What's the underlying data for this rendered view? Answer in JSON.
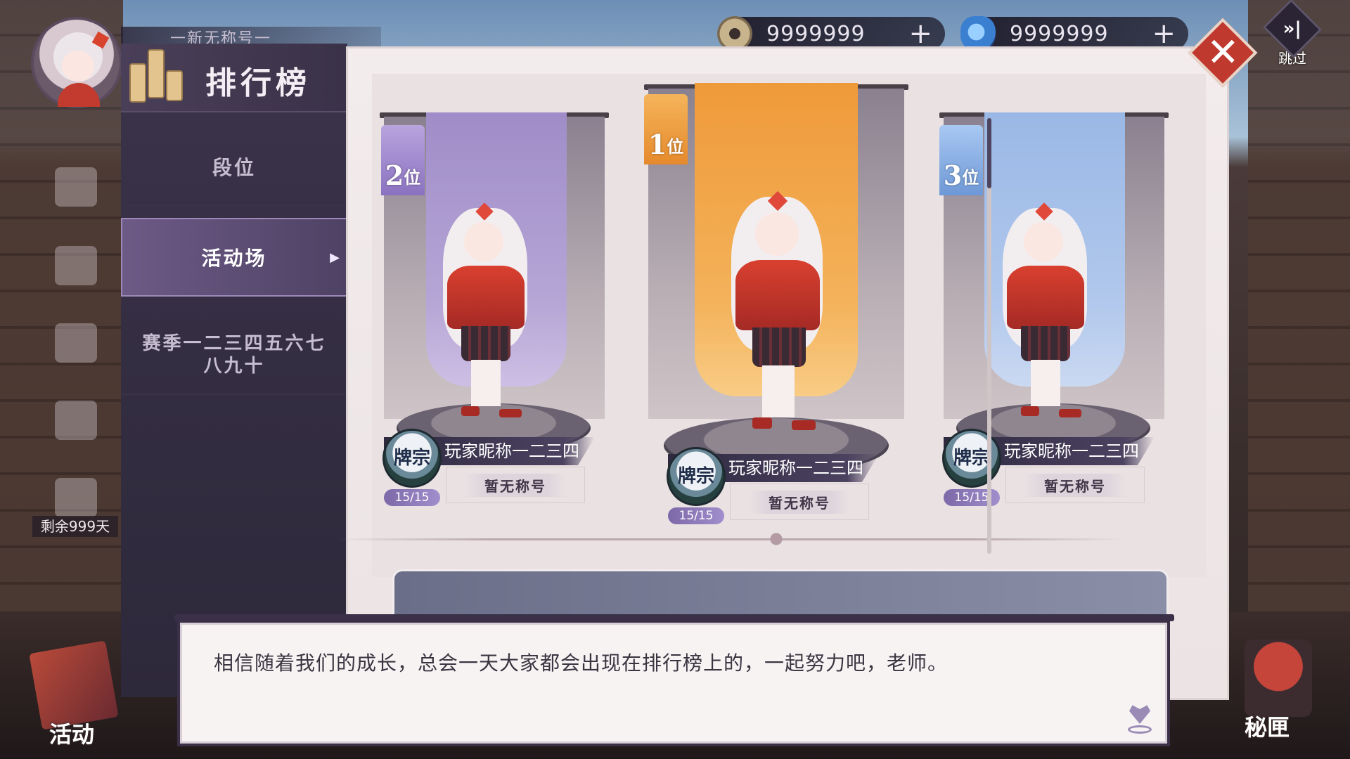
{
  "topbar": {
    "player_title": "一新无称号一",
    "currency_coin": {
      "value": "9999999",
      "plus": "+",
      "icon": "coin-icon"
    },
    "currency_gem": {
      "value": "9999999",
      "plus": "+",
      "icon": "cat-gem-icon"
    },
    "skip": {
      "icon": "skip-forward-icon",
      "label": "跳过"
    }
  },
  "sidebar": {
    "remaining": "剩余999天",
    "activity_label": "活动",
    "treasure_label": "秘匣"
  },
  "panel": {
    "title": "排行榜",
    "close_icon": "close-x-icon",
    "tabs": [
      {
        "label": "段位",
        "active": false
      },
      {
        "label": "活动场",
        "active": true
      },
      {
        "label": "赛季一二三四五六七八九十",
        "active": false
      }
    ]
  },
  "ranking": {
    "entries": [
      {
        "rank_num": "2",
        "rank_suffix": "位",
        "player_name": "玩家昵称一二三四",
        "title": "暂无称号",
        "tier_label": "牌宗",
        "tier_progress": "15/15",
        "color": "#9f87c6"
      },
      {
        "rank_num": "1",
        "rank_suffix": "位",
        "player_name": "玩家昵称一二三四",
        "title": "暂无称号",
        "tier_label": "牌宗",
        "tier_progress": "15/15",
        "color": "#f0a23c"
      },
      {
        "rank_num": "3",
        "rank_suffix": "位",
        "player_name": "玩家昵称一二三四",
        "title": "暂无称号",
        "tier_label": "牌宗",
        "tier_progress": "15/15",
        "color": "#8fb3e6"
      }
    ]
  },
  "dialog": {
    "text": "相信随着我们的成长，总会一天大家都会出现在排行榜上的，一起努力吧，老师。",
    "next_icon": "heart-continue-icon"
  }
}
